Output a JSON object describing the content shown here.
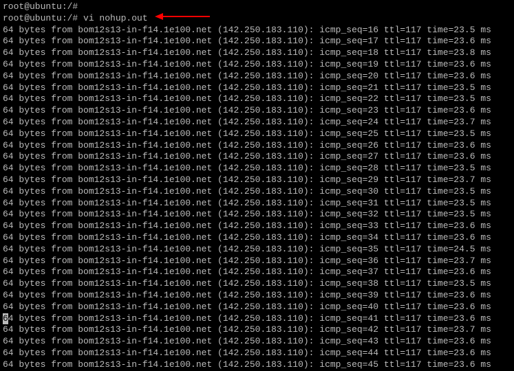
{
  "prompt1": "root@ubuntu:/#",
  "prompt2": "root@ubuntu:/# vi nohup.out",
  "ping_prefix": "64 bytes from bom12s13-in-f14.1e100.net (142.250.183.110): icmp_seq=",
  "ping_ttl": " ttl=117 time=",
  "ping_suffix": " ms",
  "cursor_row_seq": 41,
  "lines": [
    {
      "seq": 16,
      "time": "23.5"
    },
    {
      "seq": 17,
      "time": "23.6"
    },
    {
      "seq": 18,
      "time": "23.8"
    },
    {
      "seq": 19,
      "time": "23.6"
    },
    {
      "seq": 20,
      "time": "23.6"
    },
    {
      "seq": 21,
      "time": "23.5"
    },
    {
      "seq": 22,
      "time": "23.5"
    },
    {
      "seq": 23,
      "time": "23.6"
    },
    {
      "seq": 24,
      "time": "23.7"
    },
    {
      "seq": 25,
      "time": "23.5"
    },
    {
      "seq": 26,
      "time": "23.6"
    },
    {
      "seq": 27,
      "time": "23.6"
    },
    {
      "seq": 28,
      "time": "23.5"
    },
    {
      "seq": 29,
      "time": "23.7"
    },
    {
      "seq": 30,
      "time": "23.5"
    },
    {
      "seq": 31,
      "time": "23.5"
    },
    {
      "seq": 32,
      "time": "23.5"
    },
    {
      "seq": 33,
      "time": "23.6"
    },
    {
      "seq": 34,
      "time": "23.6"
    },
    {
      "seq": 35,
      "time": "24.5"
    },
    {
      "seq": 36,
      "time": "23.7"
    },
    {
      "seq": 37,
      "time": "23.6"
    },
    {
      "seq": 38,
      "time": "23.5"
    },
    {
      "seq": 39,
      "time": "23.6"
    },
    {
      "seq": 40,
      "time": "23.6"
    },
    {
      "seq": 41,
      "time": "23.6"
    },
    {
      "seq": 42,
      "time": "23.7"
    },
    {
      "seq": 43,
      "time": "23.6"
    },
    {
      "seq": 44,
      "time": "23.6"
    },
    {
      "seq": 45,
      "time": "23.6"
    }
  ],
  "arrow_color": "#ff0000"
}
